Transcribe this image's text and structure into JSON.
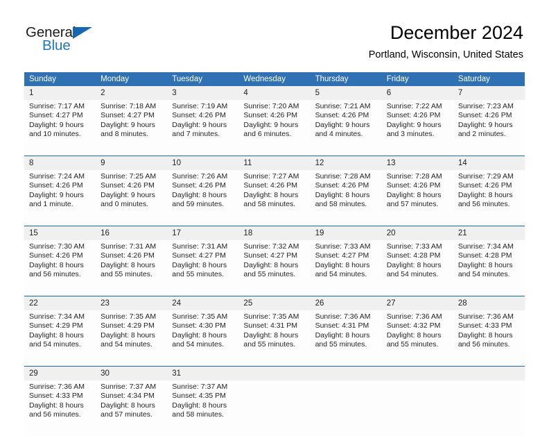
{
  "logo": {
    "primary_text": "General",
    "secondary_text": "Blue",
    "accent_color": "#1668b3"
  },
  "header": {
    "month_title": "December 2024",
    "location": "Portland, Wisconsin, United States"
  },
  "calendar": {
    "header_color": "#3071b4",
    "daynum_band_color": "#f0f0f0",
    "weekday_headers": [
      "Sunday",
      "Monday",
      "Tuesday",
      "Wednesday",
      "Thursday",
      "Friday",
      "Saturday"
    ],
    "weeks": [
      {
        "daynums": [
          "1",
          "2",
          "3",
          "4",
          "5",
          "6",
          "7"
        ],
        "cells": [
          {
            "line1": "Sunrise: 7:17 AM",
            "line2": "Sunset: 4:27 PM",
            "line3": "Daylight: 9 hours",
            "line4": "and 10 minutes."
          },
          {
            "line1": "Sunrise: 7:18 AM",
            "line2": "Sunset: 4:27 PM",
            "line3": "Daylight: 9 hours",
            "line4": "and 8 minutes."
          },
          {
            "line1": "Sunrise: 7:19 AM",
            "line2": "Sunset: 4:26 PM",
            "line3": "Daylight: 9 hours",
            "line4": "and 7 minutes."
          },
          {
            "line1": "Sunrise: 7:20 AM",
            "line2": "Sunset: 4:26 PM",
            "line3": "Daylight: 9 hours",
            "line4": "and 6 minutes."
          },
          {
            "line1": "Sunrise: 7:21 AM",
            "line2": "Sunset: 4:26 PM",
            "line3": "Daylight: 9 hours",
            "line4": "and 4 minutes."
          },
          {
            "line1": "Sunrise: 7:22 AM",
            "line2": "Sunset: 4:26 PM",
            "line3": "Daylight: 9 hours",
            "line4": "and 3 minutes."
          },
          {
            "line1": "Sunrise: 7:23 AM",
            "line2": "Sunset: 4:26 PM",
            "line3": "Daylight: 9 hours",
            "line4": "and 2 minutes."
          }
        ]
      },
      {
        "daynums": [
          "8",
          "9",
          "10",
          "11",
          "12",
          "13",
          "14"
        ],
        "cells": [
          {
            "line1": "Sunrise: 7:24 AM",
            "line2": "Sunset: 4:26 PM",
            "line3": "Daylight: 9 hours",
            "line4": "and 1 minute."
          },
          {
            "line1": "Sunrise: 7:25 AM",
            "line2": "Sunset: 4:26 PM",
            "line3": "Daylight: 9 hours",
            "line4": "and 0 minutes."
          },
          {
            "line1": "Sunrise: 7:26 AM",
            "line2": "Sunset: 4:26 PM",
            "line3": "Daylight: 8 hours",
            "line4": "and 59 minutes."
          },
          {
            "line1": "Sunrise: 7:27 AM",
            "line2": "Sunset: 4:26 PM",
            "line3": "Daylight: 8 hours",
            "line4": "and 58 minutes."
          },
          {
            "line1": "Sunrise: 7:28 AM",
            "line2": "Sunset: 4:26 PM",
            "line3": "Daylight: 8 hours",
            "line4": "and 58 minutes."
          },
          {
            "line1": "Sunrise: 7:28 AM",
            "line2": "Sunset: 4:26 PM",
            "line3": "Daylight: 8 hours",
            "line4": "and 57 minutes."
          },
          {
            "line1": "Sunrise: 7:29 AM",
            "line2": "Sunset: 4:26 PM",
            "line3": "Daylight: 8 hours",
            "line4": "and 56 minutes."
          }
        ]
      },
      {
        "daynums": [
          "15",
          "16",
          "17",
          "18",
          "19",
          "20",
          "21"
        ],
        "cells": [
          {
            "line1": "Sunrise: 7:30 AM",
            "line2": "Sunset: 4:26 PM",
            "line3": "Daylight: 8 hours",
            "line4": "and 56 minutes."
          },
          {
            "line1": "Sunrise: 7:31 AM",
            "line2": "Sunset: 4:26 PM",
            "line3": "Daylight: 8 hours",
            "line4": "and 55 minutes."
          },
          {
            "line1": "Sunrise: 7:31 AM",
            "line2": "Sunset: 4:27 PM",
            "line3": "Daylight: 8 hours",
            "line4": "and 55 minutes."
          },
          {
            "line1": "Sunrise: 7:32 AM",
            "line2": "Sunset: 4:27 PM",
            "line3": "Daylight: 8 hours",
            "line4": "and 55 minutes."
          },
          {
            "line1": "Sunrise: 7:33 AM",
            "line2": "Sunset: 4:27 PM",
            "line3": "Daylight: 8 hours",
            "line4": "and 54 minutes."
          },
          {
            "line1": "Sunrise: 7:33 AM",
            "line2": "Sunset: 4:28 PM",
            "line3": "Daylight: 8 hours",
            "line4": "and 54 minutes."
          },
          {
            "line1": "Sunrise: 7:34 AM",
            "line2": "Sunset: 4:28 PM",
            "line3": "Daylight: 8 hours",
            "line4": "and 54 minutes."
          }
        ]
      },
      {
        "daynums": [
          "22",
          "23",
          "24",
          "25",
          "26",
          "27",
          "28"
        ],
        "cells": [
          {
            "line1": "Sunrise: 7:34 AM",
            "line2": "Sunset: 4:29 PM",
            "line3": "Daylight: 8 hours",
            "line4": "and 54 minutes."
          },
          {
            "line1": "Sunrise: 7:35 AM",
            "line2": "Sunset: 4:29 PM",
            "line3": "Daylight: 8 hours",
            "line4": "and 54 minutes."
          },
          {
            "line1": "Sunrise: 7:35 AM",
            "line2": "Sunset: 4:30 PM",
            "line3": "Daylight: 8 hours",
            "line4": "and 54 minutes."
          },
          {
            "line1": "Sunrise: 7:35 AM",
            "line2": "Sunset: 4:31 PM",
            "line3": "Daylight: 8 hours",
            "line4": "and 55 minutes."
          },
          {
            "line1": "Sunrise: 7:36 AM",
            "line2": "Sunset: 4:31 PM",
            "line3": "Daylight: 8 hours",
            "line4": "and 55 minutes."
          },
          {
            "line1": "Sunrise: 7:36 AM",
            "line2": "Sunset: 4:32 PM",
            "line3": "Daylight: 8 hours",
            "line4": "and 55 minutes."
          },
          {
            "line1": "Sunrise: 7:36 AM",
            "line2": "Sunset: 4:33 PM",
            "line3": "Daylight: 8 hours",
            "line4": "and 56 minutes."
          }
        ]
      },
      {
        "daynums": [
          "29",
          "30",
          "31",
          "",
          "",
          "",
          ""
        ],
        "cells": [
          {
            "line1": "Sunrise: 7:36 AM",
            "line2": "Sunset: 4:33 PM",
            "line3": "Daylight: 8 hours",
            "line4": "and 56 minutes."
          },
          {
            "line1": "Sunrise: 7:37 AM",
            "line2": "Sunset: 4:34 PM",
            "line3": "Daylight: 8 hours",
            "line4": "and 57 minutes."
          },
          {
            "line1": "Sunrise: 7:37 AM",
            "line2": "Sunset: 4:35 PM",
            "line3": "Daylight: 8 hours",
            "line4": "and 58 minutes."
          },
          {
            "line1": "",
            "line2": "",
            "line3": "",
            "line4": ""
          },
          {
            "line1": "",
            "line2": "",
            "line3": "",
            "line4": ""
          },
          {
            "line1": "",
            "line2": "",
            "line3": "",
            "line4": ""
          },
          {
            "line1": "",
            "line2": "",
            "line3": "",
            "line4": ""
          }
        ]
      }
    ]
  }
}
